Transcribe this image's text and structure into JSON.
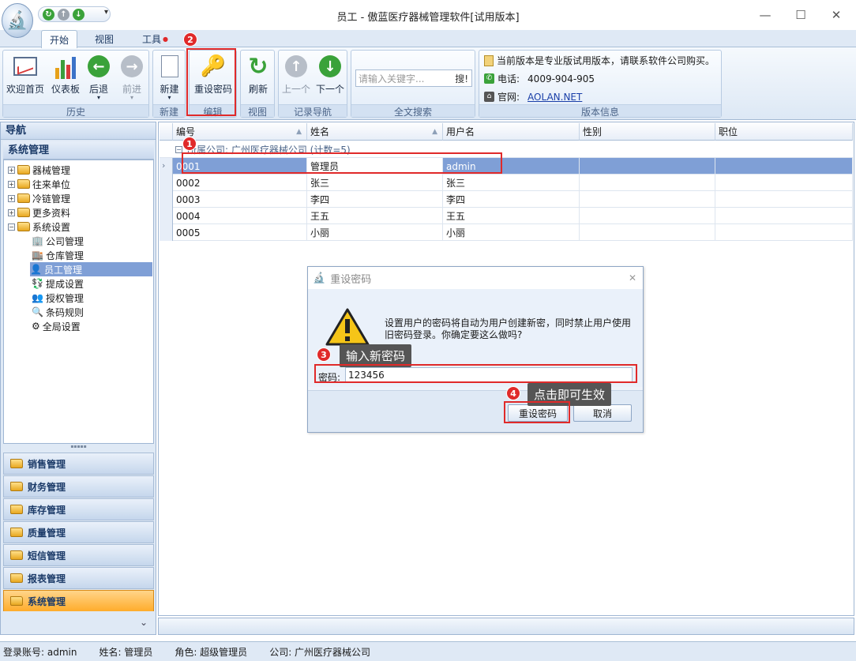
{
  "window": {
    "title": "员工 - 傲蓝医疗器械管理软件[试用版本]",
    "controls": [
      "—",
      "☐",
      "✕"
    ]
  },
  "ribbon": {
    "tabs": [
      {
        "label": "开始"
      },
      {
        "label": "视图"
      },
      {
        "label": "工具"
      }
    ],
    "groups": {
      "history": {
        "label": "历史",
        "buttons": [
          "欢迎首页",
          "仪表板",
          "后退",
          "前进"
        ]
      },
      "new": {
        "label": "新建",
        "buttons": [
          "新建"
        ]
      },
      "edit": {
        "label": "编辑",
        "buttons": [
          "重设密码"
        ]
      },
      "view": {
        "label": "视图",
        "buttons": [
          "刷新"
        ]
      },
      "recnav": {
        "label": "记录导航",
        "buttons": [
          "上一个",
          "下一个"
        ]
      },
      "search": {
        "label": "全文搜索",
        "placeholder": "请输入关键字...",
        "button": "搜!"
      },
      "version": {
        "label": "版本信息",
        "notice": "当前版本是专业版试用版本，请联系软件公司购买。",
        "phone_label": "电话:",
        "phone": "4009-904-905",
        "site_label": "官网:",
        "site": "AOLAN.NET"
      }
    }
  },
  "nav": {
    "header": "导航",
    "section": "系统管理",
    "tree": [
      {
        "label": "器械管理",
        "level": 0,
        "expander": "+"
      },
      {
        "label": "往来单位",
        "level": 0,
        "expander": "+"
      },
      {
        "label": "冷链管理",
        "level": 0,
        "expander": "+"
      },
      {
        "label": "更多资料",
        "level": 0,
        "expander": "+"
      },
      {
        "label": "系统设置",
        "level": 0,
        "expander": "−"
      },
      {
        "label": "公司管理",
        "level": 1,
        "icon": "🏢"
      },
      {
        "label": "仓库管理",
        "level": 1,
        "icon": "🏬"
      },
      {
        "label": "员工管理",
        "level": 1,
        "icon": "👤",
        "selected": true
      },
      {
        "label": "提成设置",
        "level": 1,
        "icon": "💱"
      },
      {
        "label": "授权管理",
        "level": 1,
        "icon": "👥"
      },
      {
        "label": "条码规则",
        "level": 1,
        "icon": "🔍"
      },
      {
        "label": "全局设置",
        "level": 1,
        "icon": "⚙"
      }
    ],
    "splitter": "▪▪▪▪▪",
    "sections": [
      {
        "label": "销售管理"
      },
      {
        "label": "财务管理"
      },
      {
        "label": "库存管理"
      },
      {
        "label": "质量管理"
      },
      {
        "label": "短信管理"
      },
      {
        "label": "报表管理"
      },
      {
        "label": "系统管理",
        "active": true
      }
    ],
    "more": "⌄"
  },
  "grid": {
    "columns": [
      "编号",
      "姓名",
      "用户名",
      "性别",
      "职位"
    ],
    "group_row": "所属公司: 广州医疗器械公司 (计数=5)",
    "rows": [
      {
        "id": "0001",
        "name": "管理员",
        "user": "admin",
        "gender": "",
        "position": ""
      },
      {
        "id": "0002",
        "name": "张三",
        "user": "张三",
        "gender": "",
        "position": ""
      },
      {
        "id": "0003",
        "name": "李四",
        "user": "李四",
        "gender": "",
        "position": ""
      },
      {
        "id": "0004",
        "name": "王五",
        "user": "王五",
        "gender": "",
        "position": ""
      },
      {
        "id": "0005",
        "name": "小丽",
        "user": "小丽",
        "gender": "",
        "position": ""
      }
    ]
  },
  "dialog": {
    "title": "重设密码",
    "message": "设置用户的密码将自动为用户创建新密，同时禁止用户使用旧密码登录。你确定要这么做吗?",
    "password_label": "密码:",
    "password_value": "123456",
    "ok": "重设密码",
    "cancel": "取消"
  },
  "annotations": {
    "step1": "1",
    "step2": "2",
    "step3": "3",
    "step4": "4",
    "tip3": "输入新密码",
    "tip4": "点击即可生效"
  },
  "statusbar": {
    "account": "登录账号: admin",
    "name": "姓名: 管理员",
    "role": "角色: 超级管理员",
    "company": "公司: 广州医疗器械公司"
  },
  "colors": {
    "accent": "#7f9fd6",
    "highlight_red": "#e02a2a",
    "active_section": "#ffac2b"
  }
}
